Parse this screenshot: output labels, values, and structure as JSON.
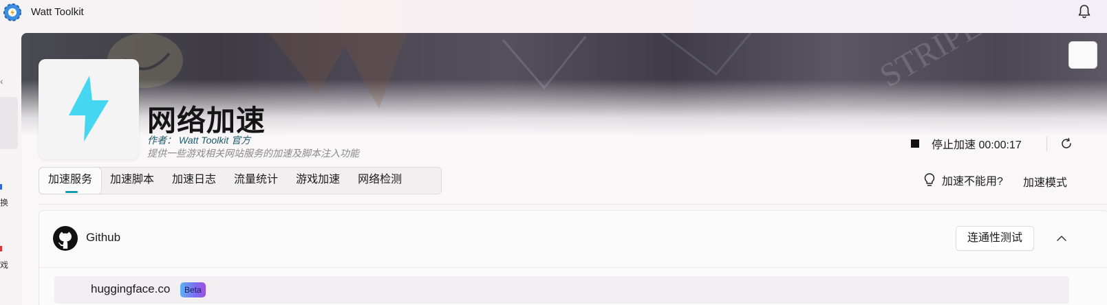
{
  "app": {
    "title": "Watt Toolkit"
  },
  "left_nav": {
    "chevron": "‹",
    "items": [
      {
        "label": "换"
      },
      {
        "label": "戏"
      }
    ]
  },
  "plugin": {
    "name": "网络加速",
    "author": "作者：  Watt Toolkit  官方",
    "description": "提供一些游戏相关网站服务的加速及脚本注入功能"
  },
  "status": {
    "stop_label": "停止加速 00:00:17"
  },
  "tabs": [
    {
      "label": "加速服务",
      "active": true
    },
    {
      "label": "加速脚本",
      "active": false
    },
    {
      "label": "加速日志",
      "active": false
    },
    {
      "label": "流量统计",
      "active": false
    },
    {
      "label": "游戏加速",
      "active": false
    },
    {
      "label": "网络检测",
      "active": false
    }
  ],
  "help": {
    "label": "加速不能用?"
  },
  "mode": {
    "label": "加速模式"
  },
  "github_card": {
    "title": "Github",
    "test_button": "连通性测试",
    "sub_item": {
      "label": "huggingface.co",
      "badge": "Beta"
    }
  },
  "colors": {
    "accent": "#0e9bb3",
    "bolt": "#45d6f2",
    "author_text": "#1d5a6b"
  },
  "icons": {
    "app_logo": "watt-toolkit-logo",
    "bell": "bell-icon",
    "bolt": "lightning-bolt-icon",
    "stop": "stop-square-icon",
    "refresh": "refresh-icon",
    "help": "lightbulb-icon",
    "github": "github-icon",
    "collapse": "chevron-up-icon"
  }
}
